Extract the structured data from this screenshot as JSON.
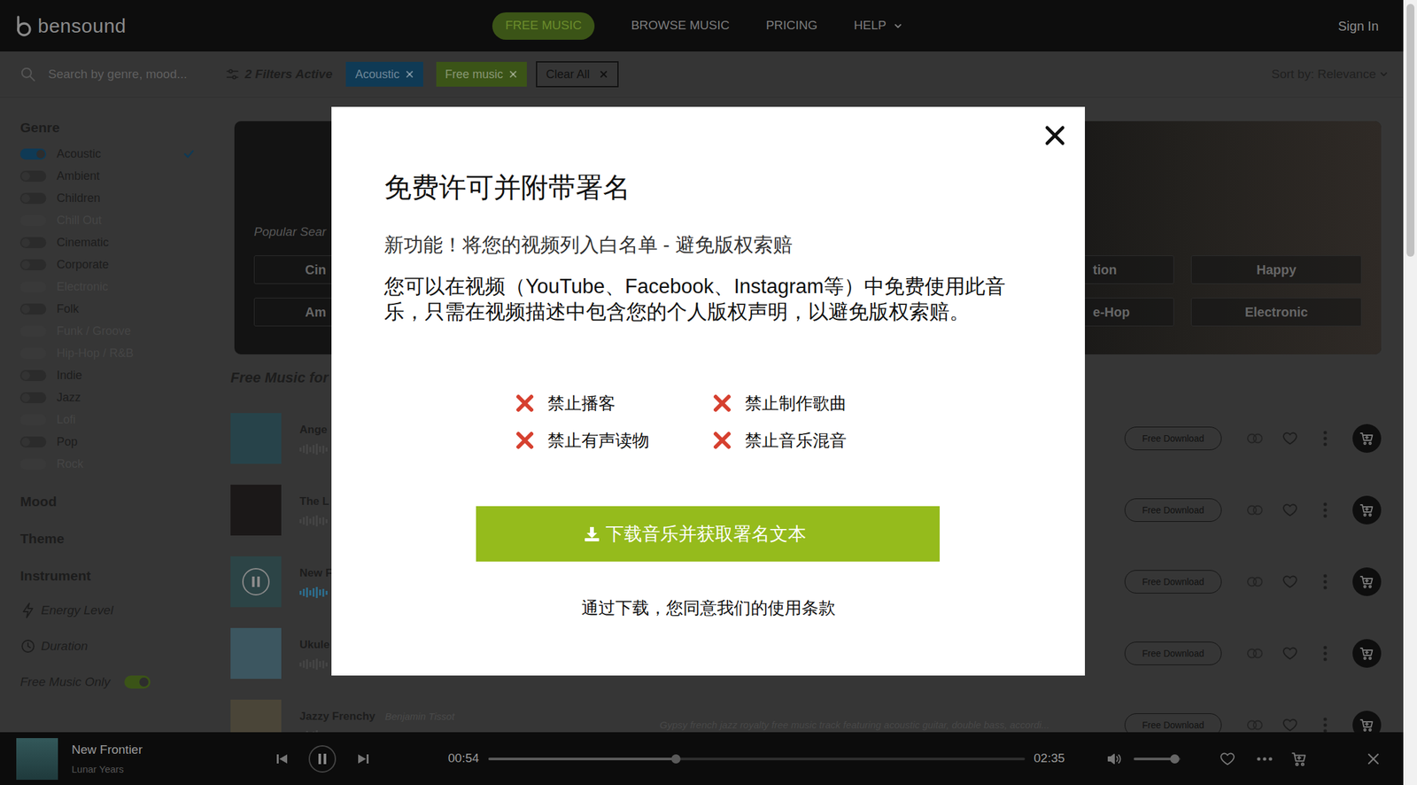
{
  "nav": {
    "logo": "bensound",
    "links": [
      {
        "label": "FREE MUSIC",
        "selected": true,
        "dropdown": false
      },
      {
        "label": "BROWSE MUSIC",
        "selected": false,
        "dropdown": false
      },
      {
        "label": "PRICING",
        "selected": false,
        "dropdown": false
      },
      {
        "label": "HELP",
        "selected": false,
        "dropdown": true
      }
    ],
    "sign_in": "Sign In"
  },
  "filter_bar": {
    "search_placeholder": "Search by genre, mood...",
    "filters_active": "2 Filters Active",
    "chips": [
      {
        "label": "Acoustic",
        "color": "#0f3a55"
      },
      {
        "label": "Free music",
        "color": "#3b5417"
      }
    ],
    "clear_all": "Clear All",
    "sort": "Sort by: Relevance"
  },
  "sidebar": {
    "genre_title": "Genre",
    "genres": [
      {
        "label": "Acoustic",
        "on": true,
        "disabled": false
      },
      {
        "label": "Ambient",
        "on": false,
        "disabled": false
      },
      {
        "label": "Children",
        "on": false,
        "disabled": false
      },
      {
        "label": "Chill Out",
        "on": false,
        "disabled": true
      },
      {
        "label": "Cinematic",
        "on": false,
        "disabled": false
      },
      {
        "label": "Corporate",
        "on": false,
        "disabled": false
      },
      {
        "label": "Electronic",
        "on": false,
        "disabled": true
      },
      {
        "label": "Folk",
        "on": false,
        "disabled": false
      },
      {
        "label": "Funk / Groove",
        "on": false,
        "disabled": true
      },
      {
        "label": "Hip-Hop / R&B",
        "on": false,
        "disabled": true
      },
      {
        "label": "Indie",
        "on": false,
        "disabled": false
      },
      {
        "label": "Jazz",
        "on": false,
        "disabled": false
      },
      {
        "label": "Lofi",
        "on": false,
        "disabled": true
      },
      {
        "label": "Pop",
        "on": false,
        "disabled": false
      },
      {
        "label": "Rock",
        "on": false,
        "disabled": true
      }
    ],
    "sections": [
      "Mood",
      "Theme",
      "Instrument"
    ],
    "energy_level": "Energy Level",
    "duration": "Duration",
    "free_only": {
      "label": "Free Music Only",
      "on": true
    }
  },
  "banner": {
    "popular_label": "Popular Sear",
    "searches": [
      [
        "Cin",
        "tion",
        "Happy"
      ],
      [
        "Am",
        "e-Hop",
        "Electronic"
      ]
    ]
  },
  "list_heading": "Free Music for",
  "tracks": [
    {
      "title": "Ange",
      "color": "#27434a",
      "playing": false,
      "download": "Free Download"
    },
    {
      "title": "The L",
      "color": "#1b1818",
      "playing": false,
      "download": "Free Download"
    },
    {
      "title": "New F",
      "color": "#2c4446",
      "playing": true,
      "download": "Free Download"
    },
    {
      "title": "Ukule",
      "color": "#3c5660",
      "playing": false,
      "download": "Free Download"
    },
    {
      "title": "Jazzy Frenchy",
      "artist": "Benjamin Tissot",
      "description": "Gypsy french jazz royalty free music track featuring acoustic guitar, double bass, accordi...",
      "color": "#4a4538",
      "playing": false,
      "download": "Free Download"
    }
  ],
  "player": {
    "title": "New Frontier",
    "artist": "Lunar Years",
    "elapsed": "00:54",
    "total": "02:35",
    "level": 0.35,
    "volume": 0.87,
    "playing": true
  },
  "modal": {
    "title": "免费许可并附带署名",
    "subtitle": "新功能！将您的视频列入白名单 - 避免版权索赔",
    "body": "您可以在视频（YouTube、Facebook、Instagram等）中免费使用此音乐，只需在视频描述中包含您的个人版权声明，以避免版权索赔。",
    "restrictions": [
      "禁止播客",
      "禁止制作歌曲",
      "禁止有声读物",
      "禁止音乐混音"
    ],
    "download_button": "下载音乐并获取署名文本",
    "terms": "通过下载，您同意我们的使用条款"
  }
}
